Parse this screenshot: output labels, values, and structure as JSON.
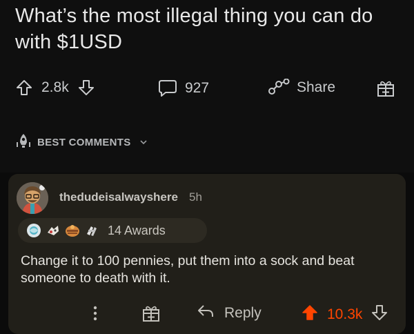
{
  "post": {
    "title": "What’s the most illegal thing you can do with $1USD"
  },
  "actions": {
    "upvote_count": "2.8k",
    "comment_count": "927",
    "share_label": "Share"
  },
  "sort": {
    "label": "BEST COMMENTS"
  },
  "comment": {
    "username": "thedudeisalwayshere",
    "time": "5h",
    "awards_text": "14 Awards",
    "text": "Change it to 100 pennies, put them into a sock and beat someone to death with it.",
    "reply_label": "Reply",
    "vote_count": "10.3k"
  },
  "colors": {
    "upvote_active": "#ff4500",
    "card_bg": "#211f19",
    "page_bg": "#0b0b0b"
  }
}
